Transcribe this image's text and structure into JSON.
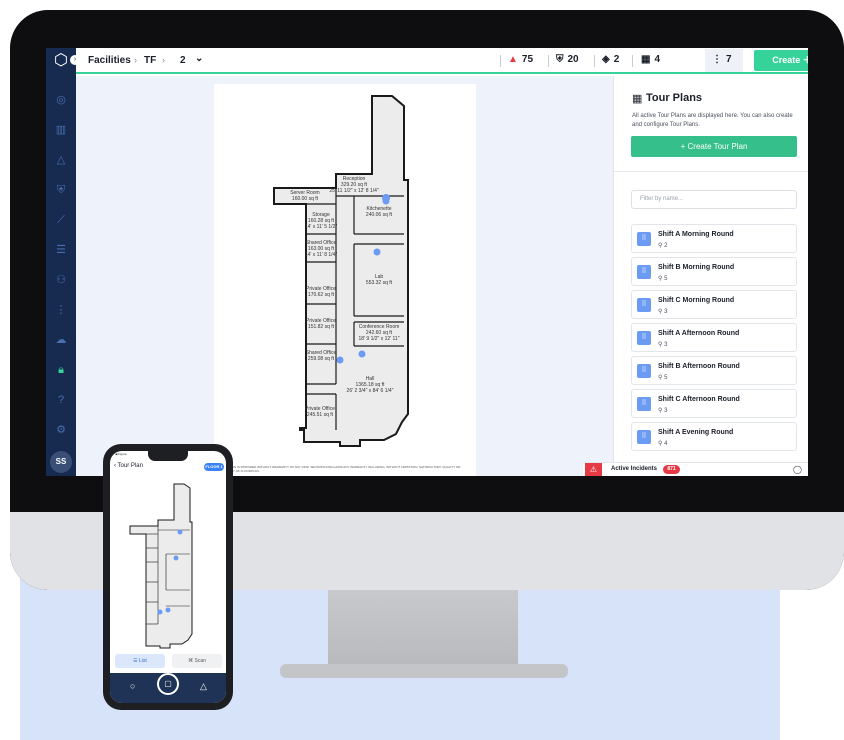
{
  "topbar": {
    "breadcrumb": [
      "Facilities",
      "TF",
      "2"
    ],
    "chevron": "⌄",
    "stats": [
      {
        "icon": "alert-triangle-icon",
        "value": "75",
        "color": "#e63946"
      },
      {
        "icon": "shield-icon",
        "value": "20",
        "color": "#1b1f2a"
      },
      {
        "icon": "layers-icon",
        "value": "2",
        "color": "#1b1f2a"
      },
      {
        "icon": "qr-code-icon",
        "value": "4",
        "color": "#1b1f2a"
      },
      {
        "icon": "route-icon",
        "value": "7",
        "color": "#1b1f2a"
      }
    ],
    "create_label": "Create ＋"
  },
  "sidebar": {
    "user_initials": "SS"
  },
  "floorplan": {
    "rooms": [
      {
        "name": "Reception",
        "area": "329.20 sq ft",
        "dims": "25' 11 1/2\" x 12' 8 1/4\""
      },
      {
        "name": "Server Room",
        "area": "160.00 sq ft"
      },
      {
        "name": "Storage",
        "area": "160.28 sq ft",
        "dims": "14' x 11' 5 1/2\""
      },
      {
        "name": "Kitchenette",
        "area": "240.06 sq ft"
      },
      {
        "name": "Shared Office",
        "area": "163.00 sq ft",
        "dims": "14' x 11' 8 1/4\""
      },
      {
        "name": "Lab",
        "area": "553.32 sq ft"
      },
      {
        "name": "Private Office",
        "area": "170.62 sq ft"
      },
      {
        "name": "Private Office",
        "area": "151.82 sq ft"
      },
      {
        "name": "Conference Room",
        "area": "242.60 sq ft",
        "dims": "18' 9 1/2\" x 12' 11\""
      },
      {
        "name": "Shared Office",
        "area": "259.08 sq ft"
      },
      {
        "name": "Hall",
        "area": "1365.18 sq ft",
        "dims": "26' 2 3/4\" x 84' 6 1/4\""
      },
      {
        "name": "Private Office",
        "area": "245.51 sq ft"
      }
    ],
    "footer": "FLOORPLAN IS PROVIDED WITHOUT WARRANTY OF ANY KIND. SENSOPIA DISCLAIMS ANY WARRANTY INCLUDING, WITHOUT LIMITATION, SATISFACTORY QUALITY OR ACCURACY OF FLOORPLAN."
  },
  "panel": {
    "title": "Tour Plans",
    "description": "All active Tour Plans are displayed here. You can also create and configure Tour Plans.",
    "create_button": "+     Create Tour Plan",
    "filter_placeholder": "Filter by name...",
    "tours": [
      {
        "name": "Shift A Morning Round",
        "count": "2"
      },
      {
        "name": "Shift B Morning Round",
        "count": "5"
      },
      {
        "name": "Shift C Morning Round",
        "count": "3"
      },
      {
        "name": "Shift A Afternoon Round",
        "count": "3"
      },
      {
        "name": "Shift B Afternoon Round",
        "count": "5"
      },
      {
        "name": "Shift C Afternoon Round",
        "count": "3"
      },
      {
        "name": "Shift A Evening Round",
        "count": "4"
      }
    ]
  },
  "incidents": {
    "label": "Active Incidents",
    "count": "871"
  },
  "phone": {
    "status_left": "◀ Figma",
    "back_label": "‹ Tour Plan",
    "floor_badge": "FLOOR 1",
    "tab_list": "☰  List",
    "tab_scan": "⌘  Scan"
  },
  "colors": {
    "accent": "#35d39a",
    "sidebar": "#172a4f",
    "alert": "#e63946",
    "tour_icon": "#6b9bf2"
  }
}
